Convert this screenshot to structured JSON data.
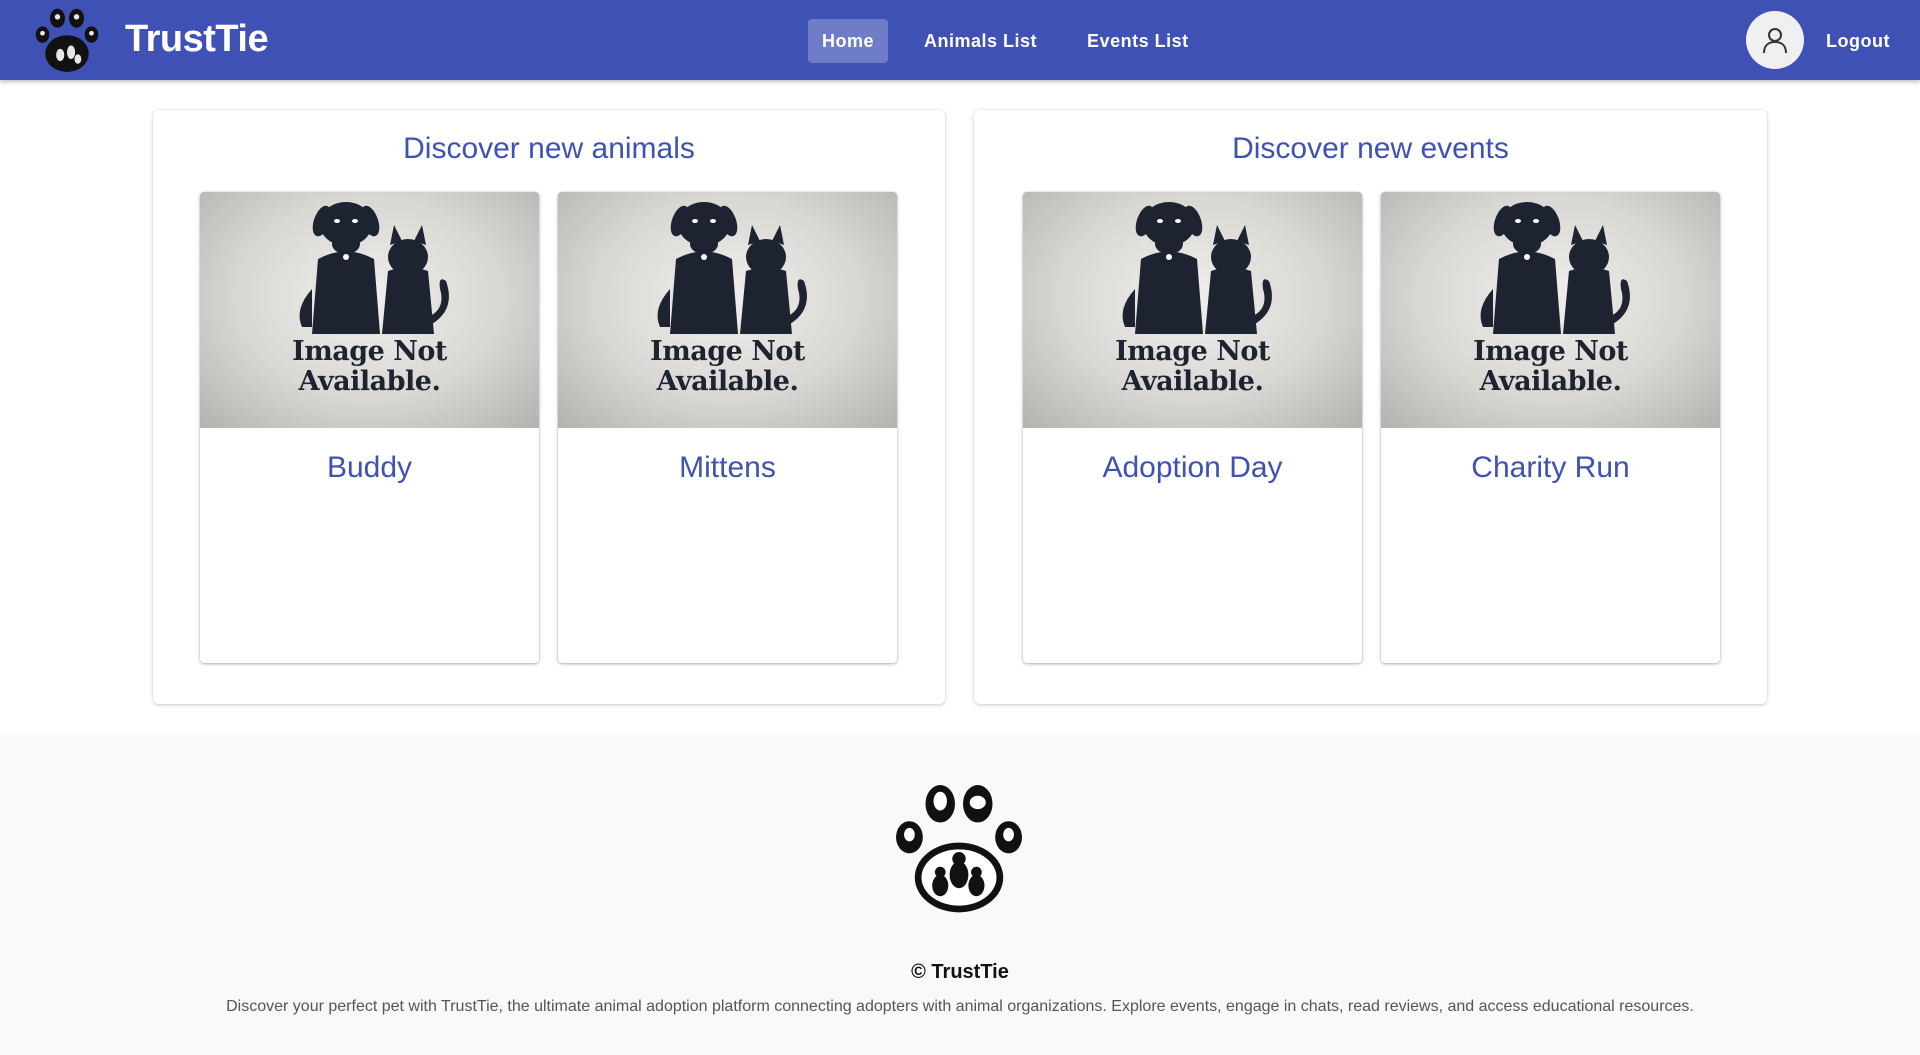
{
  "navbar": {
    "brand": "TrustTie",
    "links": [
      {
        "label": "Home",
        "active": true
      },
      {
        "label": "Animals List",
        "active": false
      },
      {
        "label": "Events List",
        "active": false
      }
    ],
    "logout_label": "Logout",
    "accent_color": "#3f51b5"
  },
  "animals_panel": {
    "title": "Discover new animals",
    "cards": [
      {
        "title": "Buddy",
        "image_text": [
          "Image Not",
          "Available."
        ]
      },
      {
        "title": "Mittens",
        "image_text": [
          "Image Not",
          "Available."
        ]
      }
    ]
  },
  "events_panel": {
    "title": "Discover new events",
    "cards": [
      {
        "title": "Adoption Day",
        "image_text": [
          "Image Not",
          "Available."
        ]
      },
      {
        "title": "Charity Run",
        "image_text": [
          "Image Not",
          "Available."
        ]
      }
    ]
  },
  "footer": {
    "copyright": "© TrustTie",
    "description": "Discover your perfect pet with TrustTie, the ultimate animal adoption platform connecting adopters with animal organizations. Explore events, engage in chats, read reviews, and access educational resources."
  }
}
